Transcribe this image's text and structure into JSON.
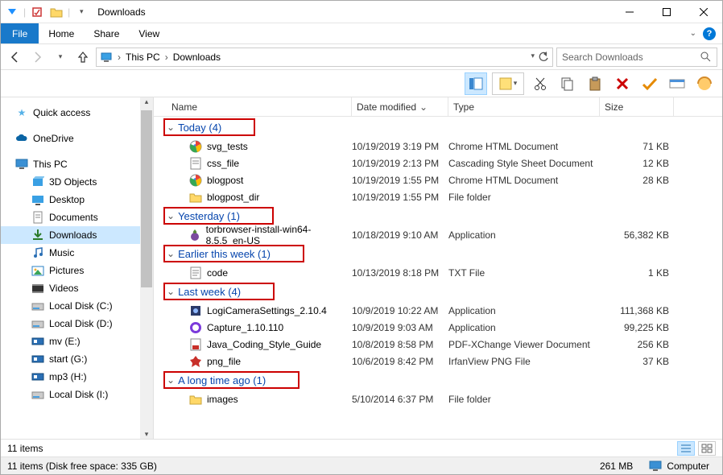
{
  "title": "Downloads",
  "menu": {
    "file": "File",
    "home": "Home",
    "share": "Share",
    "view": "View"
  },
  "breadcrumb": {
    "root": "This PC",
    "leaf": "Downloads"
  },
  "search": {
    "placeholder": "Search Downloads"
  },
  "sidebar": {
    "quick_access": "Quick access",
    "onedrive": "OneDrive",
    "this_pc": "This PC",
    "items": [
      {
        "label": "3D Objects"
      },
      {
        "label": "Desktop"
      },
      {
        "label": "Documents"
      },
      {
        "label": "Downloads",
        "selected": true
      },
      {
        "label": "Music"
      },
      {
        "label": "Pictures"
      },
      {
        "label": "Videos"
      },
      {
        "label": "Local Disk (C:)"
      },
      {
        "label": "Local Disk (D:)"
      },
      {
        "label": "mv (E:)"
      },
      {
        "label": "start (G:)"
      },
      {
        "label": "mp3 (H:)"
      },
      {
        "label": "Local Disk (I:)"
      }
    ]
  },
  "columns": {
    "name": "Name",
    "date": "Date modified",
    "type": "Type",
    "size": "Size"
  },
  "groups": [
    {
      "label": "Today (4)",
      "rows": [
        {
          "icon": "chrome",
          "name": "svg_tests",
          "date": "10/19/2019 3:19 PM",
          "type": "Chrome HTML Document",
          "size": "71 KB"
        },
        {
          "icon": "css",
          "name": "css_file",
          "date": "10/19/2019 2:13 PM",
          "type": "Cascading Style Sheet Document",
          "size": "12 KB"
        },
        {
          "icon": "chrome",
          "name": "blogpost",
          "date": "10/19/2019 1:55 PM",
          "type": "Chrome HTML Document",
          "size": "28 KB"
        },
        {
          "icon": "folder",
          "name": "blogpost_dir",
          "date": "10/19/2019 1:55 PM",
          "type": "File folder",
          "size": ""
        }
      ]
    },
    {
      "label": "Yesterday (1)",
      "rows": [
        {
          "icon": "onion",
          "name": "torbrowser-install-win64-8.5.5_en-US",
          "date": "10/18/2019 9:10 AM",
          "type": "Application",
          "size": "56,382 KB"
        }
      ]
    },
    {
      "label": "Earlier this week (1)",
      "rows": [
        {
          "icon": "txt",
          "name": "code",
          "date": "10/13/2019 8:18 PM",
          "type": "TXT File",
          "size": "1 KB"
        }
      ]
    },
    {
      "label": "Last week (4)",
      "rows": [
        {
          "icon": "app",
          "name": "LogiCameraSettings_2.10.4",
          "date": "10/9/2019 10:22 AM",
          "type": "Application",
          "size": "111,368 KB"
        },
        {
          "icon": "cap",
          "name": "Capture_1.10.110",
          "date": "10/9/2019 9:03 AM",
          "type": "Application",
          "size": "99,225 KB"
        },
        {
          "icon": "pdf",
          "name": "Java_Coding_Style_Guide",
          "date": "10/8/2019 8:58 PM",
          "type": "PDF-XChange Viewer Document",
          "size": "256 KB"
        },
        {
          "icon": "png",
          "name": "png_file",
          "date": "10/6/2019 8:42 PM",
          "type": "IrfanView PNG File",
          "size": "37 KB"
        }
      ]
    },
    {
      "label": "A long time ago (1)",
      "rows": [
        {
          "icon": "folder",
          "name": "images",
          "date": "5/10/2014 6:37 PM",
          "type": "File folder",
          "size": ""
        }
      ]
    }
  ],
  "status": {
    "count": "11 items",
    "detail": "11 items (Disk free space: 335 GB)",
    "size": "261 MB",
    "location": "Computer"
  }
}
